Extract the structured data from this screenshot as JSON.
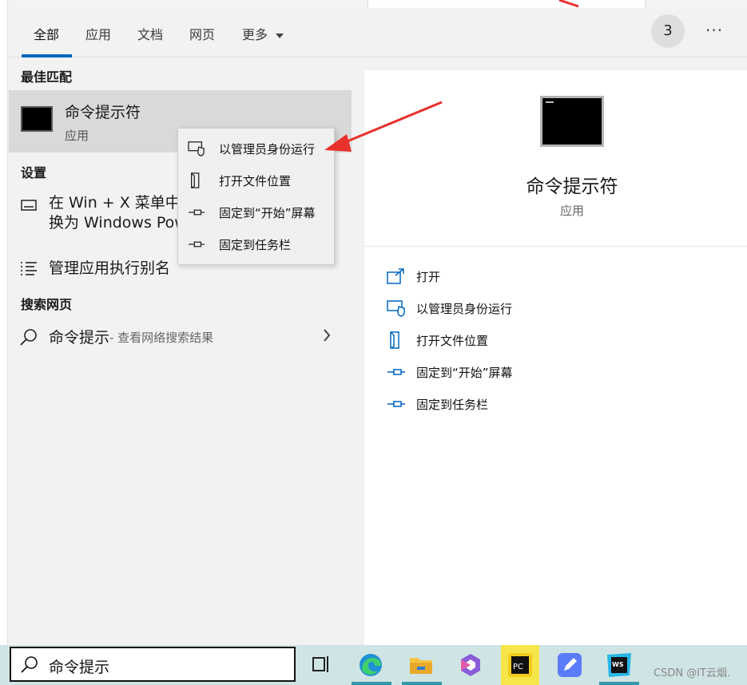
{
  "tabs": [
    {
      "label": "全部",
      "active": true
    },
    {
      "label": "应用",
      "active": false
    },
    {
      "label": "文档",
      "active": false
    },
    {
      "label": "网页",
      "active": false
    },
    {
      "label": "更多",
      "active": false
    }
  ],
  "header": {
    "badge_count": "3",
    "more_label": "···"
  },
  "best_match": {
    "section": "最佳匹配",
    "title": "命令提示符",
    "subtitle": "应用"
  },
  "settings": {
    "section": "设置",
    "item1_line1": "在 Win + X 菜单中",
    "item1_line2": "换为 Windows Pow",
    "item2": "管理应用执行别名"
  },
  "web": {
    "section": "搜索网页",
    "query": "命令提示",
    "hint": " - 查看网络搜索结果"
  },
  "context_menu": [
    {
      "label": "以管理员身份运行",
      "icon": "shield-window-icon"
    },
    {
      "label": "打开文件位置",
      "icon": "file-location-icon"
    },
    {
      "label": "固定到“开始”屏幕",
      "icon": "pin-icon"
    },
    {
      "label": "固定到任务栏",
      "icon": "pin-icon"
    }
  ],
  "preview": {
    "title": "命令提示符",
    "subtitle": "应用",
    "actions": [
      {
        "label": "打开",
        "icon": "open-icon"
      },
      {
        "label": "以管理员身份运行",
        "icon": "shield-window-icon"
      },
      {
        "label": "打开文件位置",
        "icon": "file-location-icon"
      },
      {
        "label": "固定到“开始”屏幕",
        "icon": "pin-icon"
      },
      {
        "label": "固定到任务栏",
        "icon": "pin-icon"
      }
    ]
  },
  "taskbar": {
    "search_value": "命令提示",
    "watermark": "CSDN @IT云烟."
  },
  "colors": {
    "accent": "#0067c0",
    "arrow": "#e8302c"
  }
}
